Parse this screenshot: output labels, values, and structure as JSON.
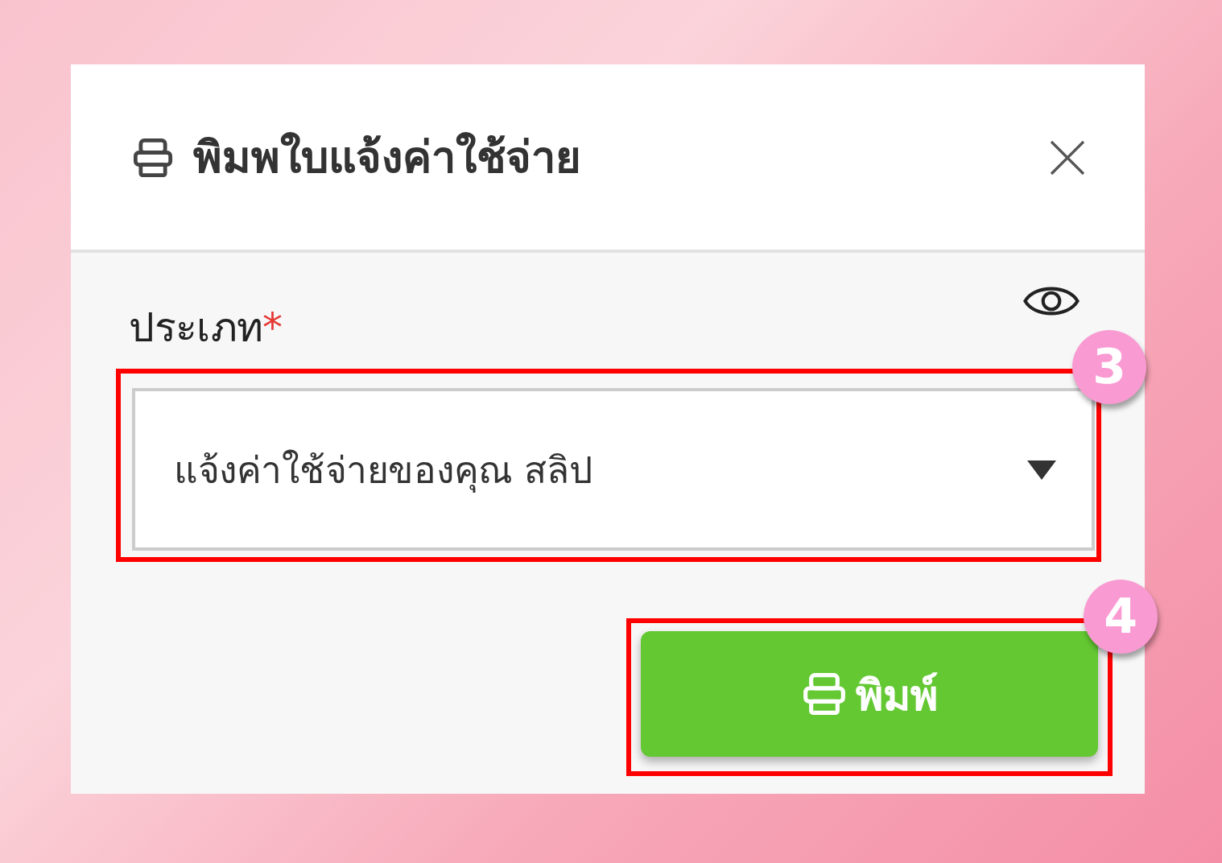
{
  "dialog": {
    "title": "พิมพใบแจ้งค่าใช้จ่าย",
    "field": {
      "label": "ประเภท",
      "required_mark": "*",
      "value": "แจ้งค่าใช้จ่ายของคุณ สลิป",
      "step": "3"
    },
    "print_button": {
      "label": "พิมพ์",
      "step": "4"
    }
  }
}
